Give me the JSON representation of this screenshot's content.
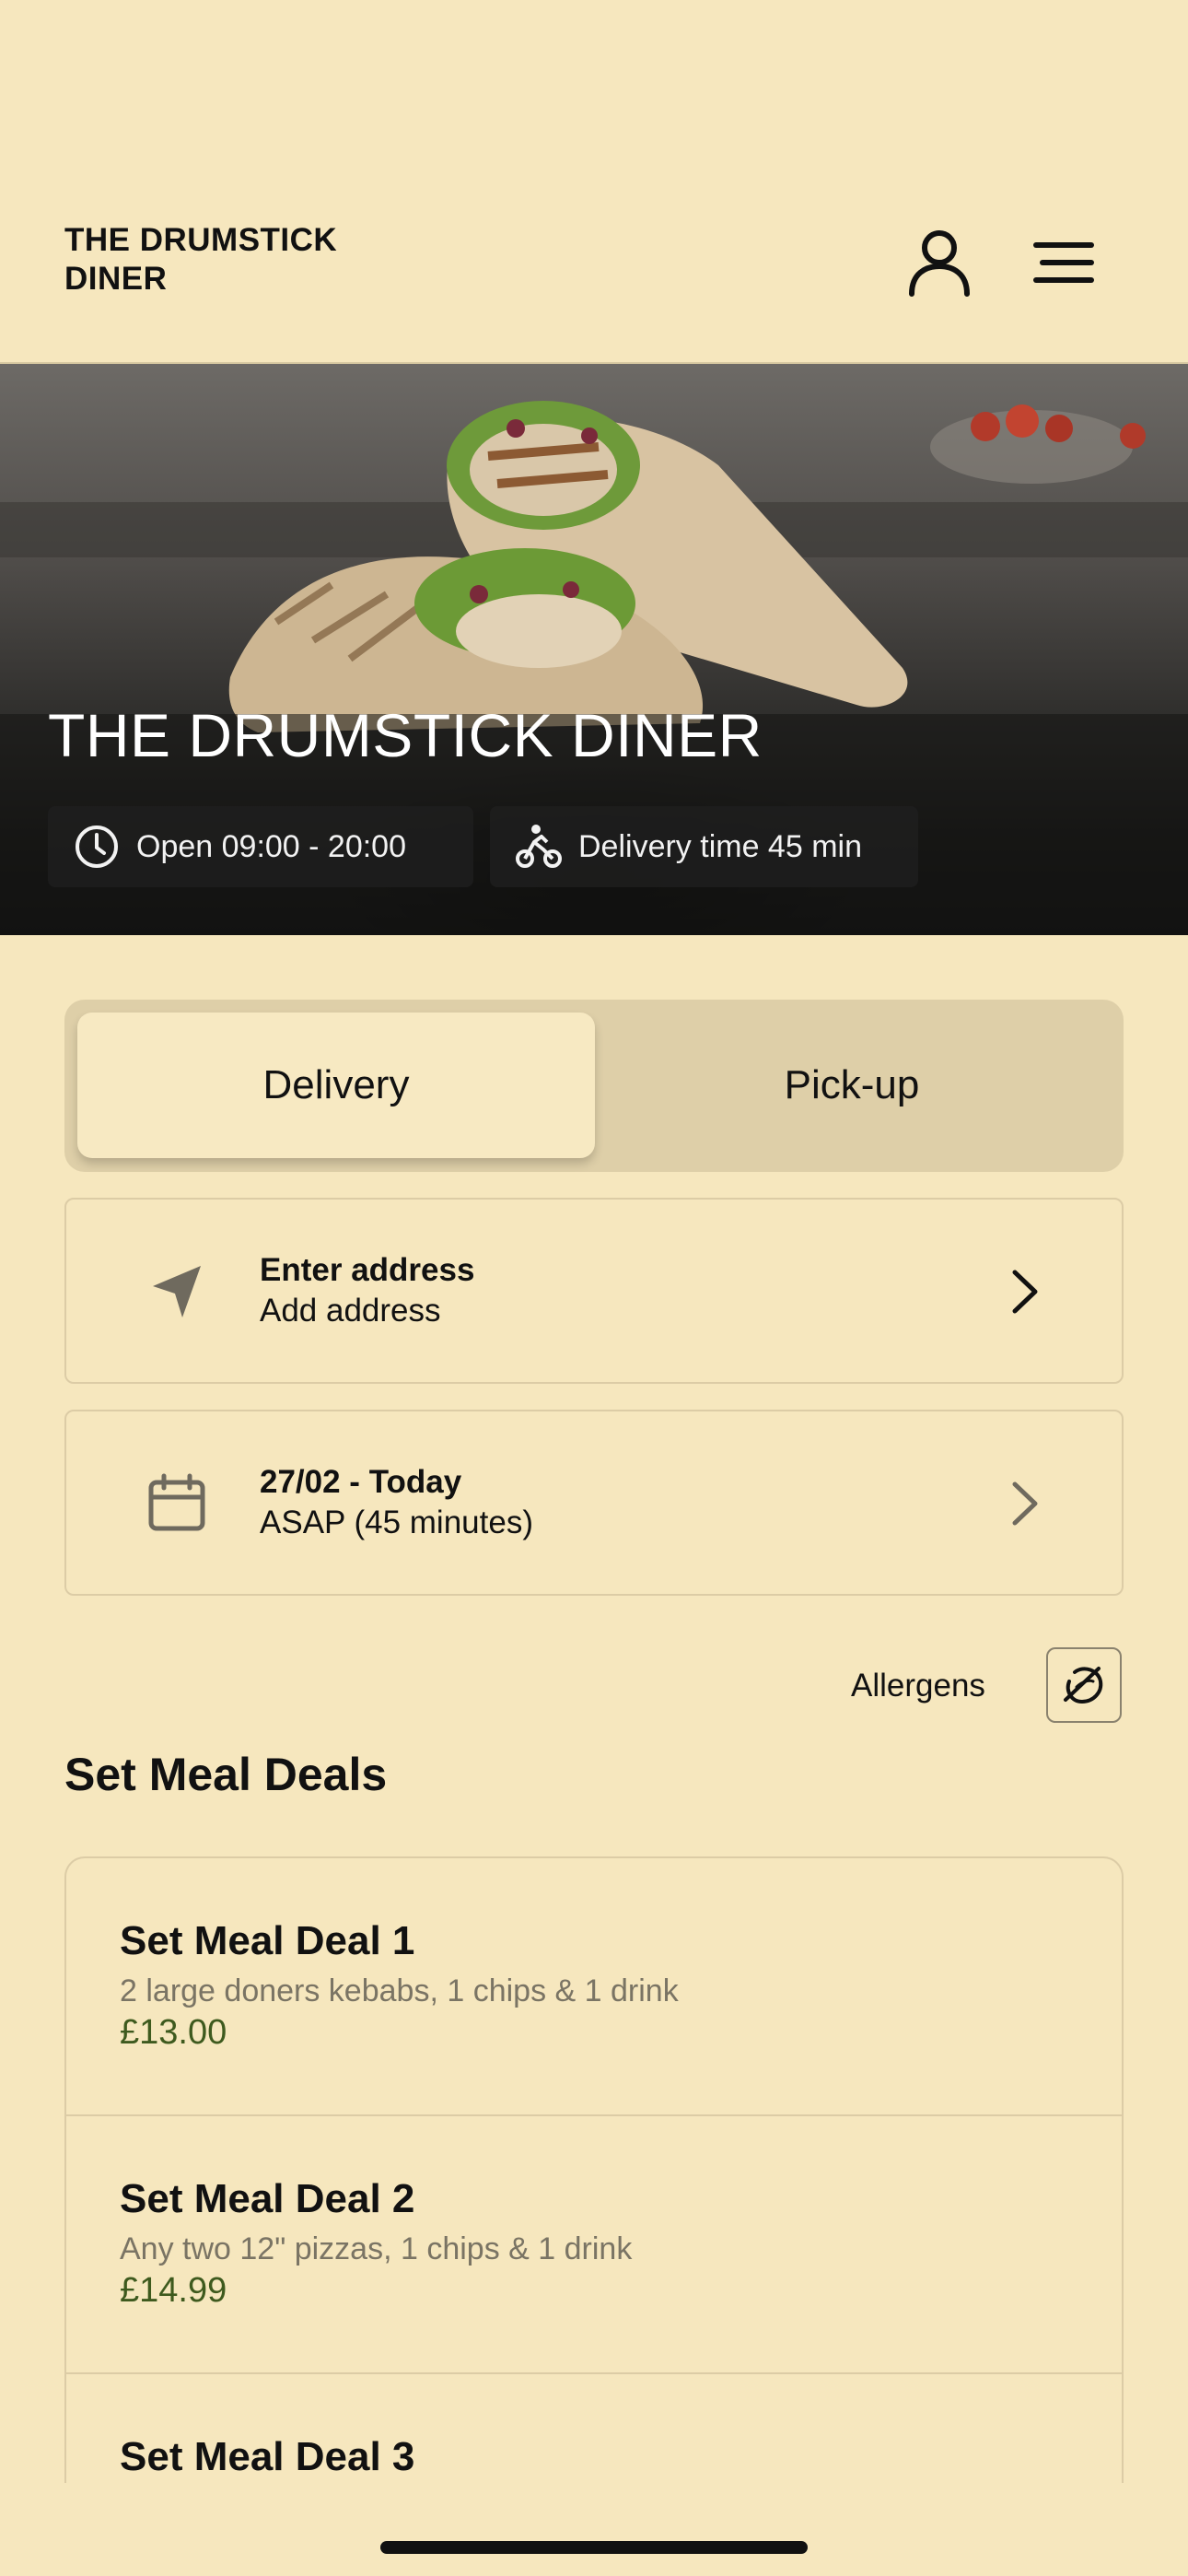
{
  "header": {
    "brand": "THE DRUMSTICK DINER",
    "account_icon": "person-icon",
    "menu_icon": "hamburger-menu-icon"
  },
  "hero": {
    "title": "THE DRUMSTICK DINER",
    "open_hours": "Open 09:00 - 20:00",
    "delivery_time": "Delivery time 45 min",
    "open_icon": "clock-icon",
    "delivery_icon": "cyclist-icon"
  },
  "order_mode": {
    "options": [
      "Delivery",
      "Pick-up"
    ],
    "selected": "Delivery"
  },
  "address": {
    "title": "Enter address",
    "subtitle": "Add address",
    "icon": "location-arrow-icon"
  },
  "schedule": {
    "title": "27/02 - Today",
    "subtitle": "ASAP (45 minutes)",
    "icon": "calendar-icon"
  },
  "allergens": {
    "label": "Allergens",
    "icon": "allergen-nut-icon"
  },
  "section": {
    "title": "Set Meal Deals"
  },
  "deals": [
    {
      "title": "Set Meal Deal 1",
      "description": "2 large doners kebabs, 1 chips & 1 drink",
      "price": "£13.00"
    },
    {
      "title": "Set Meal Deal 2",
      "description": "Any two 12\" pizzas, 1 chips & 1 drink",
      "price": "£14.99"
    },
    {
      "title": "Set Meal Deal 3",
      "description": "",
      "price": ""
    }
  ],
  "colors": {
    "background": "#F6E7BE",
    "price": "#3e5a1e",
    "toggle_track": "#DECFA8"
  }
}
